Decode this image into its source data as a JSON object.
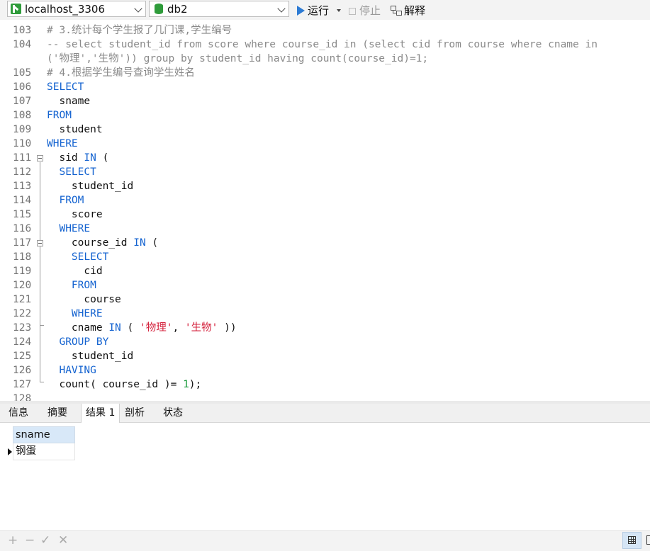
{
  "toolbar": {
    "connection": "localhost_3306",
    "database": "db2",
    "run_label": "运行",
    "stop_label": "停止",
    "explain_label": "解释"
  },
  "editor": {
    "lines": [
      {
        "n": "103",
        "t": "# 3.统计每个学生报了几门课,学生编号"
      },
      {
        "n": "104",
        "t": "-- select student_id from score where course_id in (select cid from course where cname in"
      },
      {
        "n": "",
        "t": "('物理','生物')) group by student_id having count(course_id)=1;"
      },
      {
        "n": "105",
        "t": "# 4.根据学生编号查询学生姓名"
      },
      {
        "n": "106",
        "t": "SELECT"
      },
      {
        "n": "107",
        "t": "  sname"
      },
      {
        "n": "108",
        "t": "FROM"
      },
      {
        "n": "109",
        "t": "  student"
      },
      {
        "n": "110",
        "t": "WHERE"
      },
      {
        "n": "111",
        "t": "  sid IN ("
      },
      {
        "n": "112",
        "t": "  SELECT"
      },
      {
        "n": "113",
        "t": "    student_id"
      },
      {
        "n": "114",
        "t": "  FROM"
      },
      {
        "n": "115",
        "t": "    score"
      },
      {
        "n": "116",
        "t": "  WHERE"
      },
      {
        "n": "117",
        "t": "    course_id IN ("
      },
      {
        "n": "118",
        "t": "    SELECT"
      },
      {
        "n": "119",
        "t": "      cid"
      },
      {
        "n": "120",
        "t": "    FROM"
      },
      {
        "n": "121",
        "t": "      course"
      },
      {
        "n": "122",
        "t": "    WHERE"
      },
      {
        "n": "123",
        "t": "    cname IN ( '物理', '生物' ))"
      },
      {
        "n": "124",
        "t": "  GROUP BY"
      },
      {
        "n": "125",
        "t": "    student_id"
      },
      {
        "n": "126",
        "t": "  HAVING"
      },
      {
        "n": "127",
        "t": "  count( course_id )= 1);"
      },
      {
        "n": "128",
        "t": ""
      }
    ]
  },
  "tabs": {
    "info": "信息",
    "summary": "摘要",
    "result1": "结果 1",
    "profile": "剖析",
    "status": "状态"
  },
  "results": {
    "column": "sname",
    "row_value": "钢蛋"
  },
  "bottombar": {
    "add": "+",
    "remove": "−",
    "apply": "✓",
    "discard": "✕"
  }
}
